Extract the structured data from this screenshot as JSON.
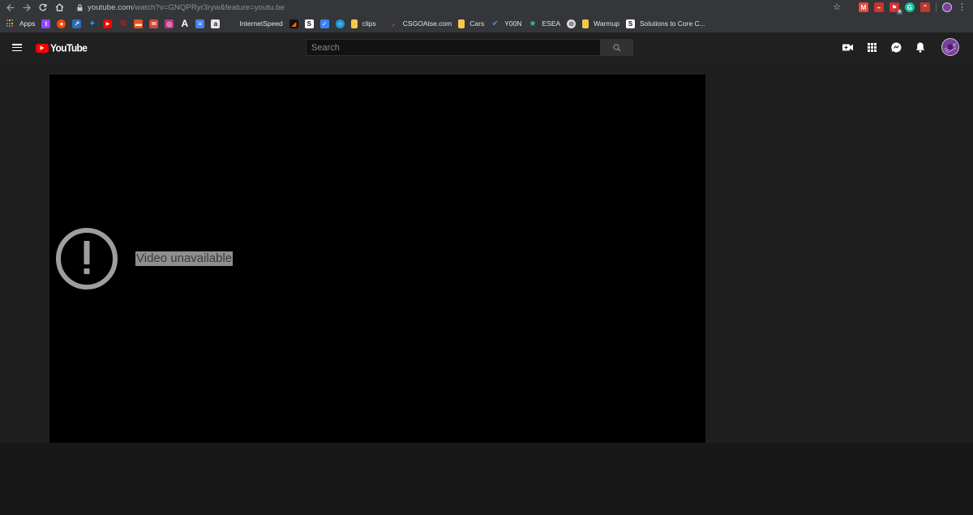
{
  "browser": {
    "url_host": "youtube.com",
    "url_rest": "/watch?v=GNQPRyr3ryw&feature=youtu.be",
    "bookmarks": [
      {
        "label": "Apps",
        "icon": "apps-grid-icon"
      },
      {
        "label": "",
        "icon": "twitch-icon",
        "color": "#9146ff"
      },
      {
        "label": "",
        "icon": "reddit-icon",
        "color": "#ff4500"
      },
      {
        "label": "",
        "icon": "chart-icon",
        "color": "#2d6db5"
      },
      {
        "label": "",
        "icon": "twitter-icon",
        "color": "#1da1f2"
      },
      {
        "label": "",
        "icon": "youtube-icon",
        "color": "#ff0000"
      },
      {
        "label": "",
        "icon": "netflix-icon",
        "color": "#e50914"
      },
      {
        "label": "",
        "icon": "slides-icon",
        "color": "#e8531e"
      },
      {
        "label": "",
        "icon": "gmail-icon",
        "color": "#d44638"
      },
      {
        "label": "",
        "icon": "instagram-icon",
        "color": "#c13584"
      },
      {
        "label": "",
        "icon": "font-a-icon",
        "color": "#35363a"
      },
      {
        "label": "",
        "icon": "docs-icon",
        "color": "#4285f4"
      },
      {
        "label": "",
        "icon": "amazon-icon",
        "color": "#e6e6e6"
      },
      {
        "label": "InternetSpeed",
        "icon": "",
        "color": ""
      },
      {
        "label": "",
        "icon": "speed-icon",
        "color": "#111111"
      },
      {
        "label": "",
        "icon": "s-icon",
        "color": "#ffffff"
      },
      {
        "label": "",
        "icon": "check-icon",
        "color": "#3b82f6"
      },
      {
        "label": "",
        "icon": "circle-icon",
        "color": "#1a9bd7"
      },
      {
        "label": "clips",
        "icon": "folder-icon",
        "color": "#f2c94c"
      },
      {
        "label": "CSGOAtse.com",
        "icon": "knife-icon",
        "color": "#c08040"
      },
      {
        "label": "Cars",
        "icon": "folder-icon",
        "color": "#f2c94c"
      },
      {
        "label": "Y00N",
        "icon": "checkmark-icon",
        "color": "#4a90e2"
      },
      {
        "label": "ESEA",
        "icon": "star-icon",
        "color": "#2ecc71"
      },
      {
        "label": "",
        "icon": "globe-icon",
        "color": "#dcdcdc"
      },
      {
        "label": "Warmup",
        "icon": "folder-icon",
        "color": "#f2c94c"
      },
      {
        "label": "Solutions to Core C...",
        "icon": "s-icon",
        "color": "#ffffff"
      }
    ],
    "extensions": [
      {
        "icon": "gmail-ext-icon",
        "color": "#e74c3c",
        "badge": ""
      },
      {
        "icon": "chart-ext-icon",
        "color": "#c0392b",
        "badge": ""
      },
      {
        "icon": "flag-ext-icon",
        "color": "#d32f2f",
        "badge": "4"
      },
      {
        "icon": "grammarly-icon",
        "color": "#15c39a",
        "badge": ""
      },
      {
        "icon": "arrows-ext-icon",
        "color": "#c0392b",
        "badge": ""
      }
    ]
  },
  "youtube": {
    "logo_text": "YouTube",
    "search_placeholder": "Search",
    "error_message": "Video unavailable"
  }
}
